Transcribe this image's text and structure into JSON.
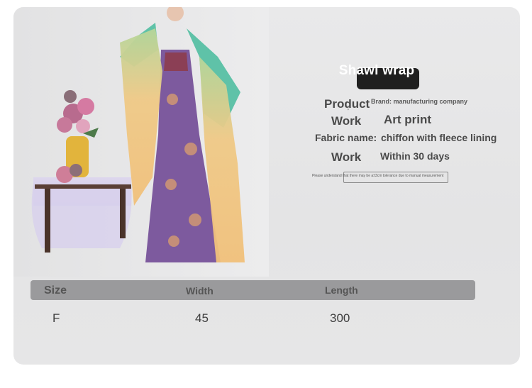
{
  "product": {
    "title": "Shawl wrap",
    "specs": [
      {
        "label": "Product",
        "value": "Brand: manufacturing company"
      },
      {
        "label": "Work",
        "value": "Art print"
      },
      {
        "label": "Fabric name:",
        "value": "chiffon with fleece lining"
      },
      {
        "label": "Work",
        "value": "Within 30 days"
      }
    ],
    "notice": "Please understand that there may be a±3cm tolerance due to manual measurement"
  },
  "size_table": {
    "headers": [
      "Size",
      "Width",
      "Length"
    ],
    "rows": [
      [
        "F",
        "45",
        "300"
      ]
    ]
  },
  "photo": {
    "subject": "model wearing shawl wrap with flower vase on side table",
    "colors": {
      "shawl": "#e9c27a",
      "sleeve": "#5fc2a8",
      "dress": "#7d5a9e"
    }
  }
}
